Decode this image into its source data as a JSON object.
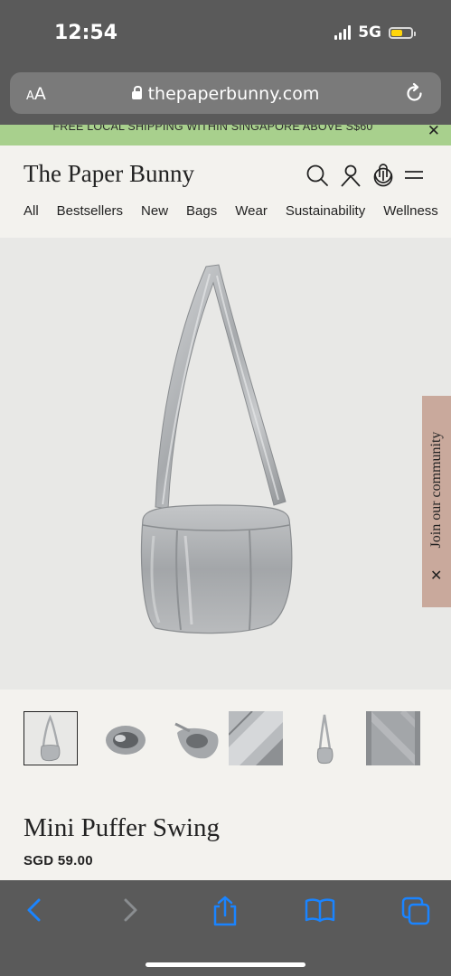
{
  "status_bar": {
    "time": "12:54",
    "network": "5G",
    "battery_level": 0.55,
    "battery_color": "#ffd60a"
  },
  "browser": {
    "text_size_label": "AA",
    "url": "thepaperbunny.com"
  },
  "promo": {
    "text": "FREE LOCAL SHIPPING WITHIN SINGAPORE ABOVE S$60",
    "close_icon": "close-icon",
    "color": "#a8d08d"
  },
  "header": {
    "logo": "The Paper Bunny",
    "icons": [
      "search-icon",
      "account-icon",
      "cart-icon",
      "menu-icon"
    ]
  },
  "nav": {
    "items": [
      "All",
      "Bestsellers",
      "New",
      "Bags",
      "Wear",
      "Sustainability",
      "Wellness"
    ]
  },
  "community_tab": {
    "label": "Join our community",
    "close_icon": "close-icon",
    "color": "#c9a99c"
  },
  "product": {
    "title": "Mini Puffer Swing",
    "price": "SGD 59.00",
    "thumbnail_count": 6,
    "active_thumbnail": 1
  },
  "toolbar": {
    "icons": [
      "back-icon",
      "forward-icon",
      "share-icon",
      "bookmarks-icon",
      "tabs-icon"
    ],
    "accent": "#1a84ff"
  }
}
